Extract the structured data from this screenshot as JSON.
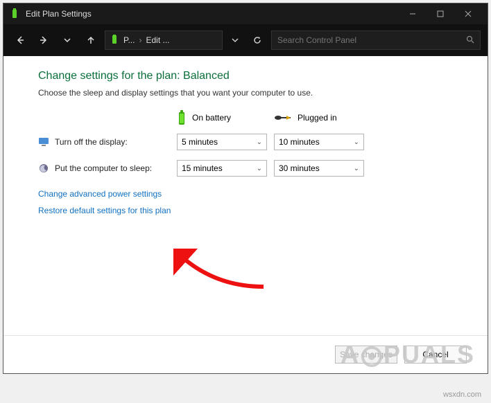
{
  "titlebar": {
    "title": "Edit Plan Settings"
  },
  "breadcrumb": {
    "item1": "P...",
    "item2": "Edit ..."
  },
  "search": {
    "placeholder": "Search Control Panel"
  },
  "main": {
    "heading": "Change settings for the plan: Balanced",
    "sub": "Choose the sleep and display settings that you want your computer to use.",
    "col_battery": "On battery",
    "col_plugged": "Plugged in",
    "row_display_label": "Turn off the display:",
    "row_sleep_label": "Put the computer to sleep:",
    "display_battery": "5 minutes",
    "display_plugged": "10 minutes",
    "sleep_battery": "15 minutes",
    "sleep_plugged": "30 minutes",
    "link_advanced": "Change advanced power settings",
    "link_restore": "Restore default settings for this plan"
  },
  "footer": {
    "save": "Save changes",
    "cancel": "Cancel"
  },
  "watermark": {
    "pre": "A",
    "post": "PUALS",
    "site": "wsxdn.com"
  }
}
